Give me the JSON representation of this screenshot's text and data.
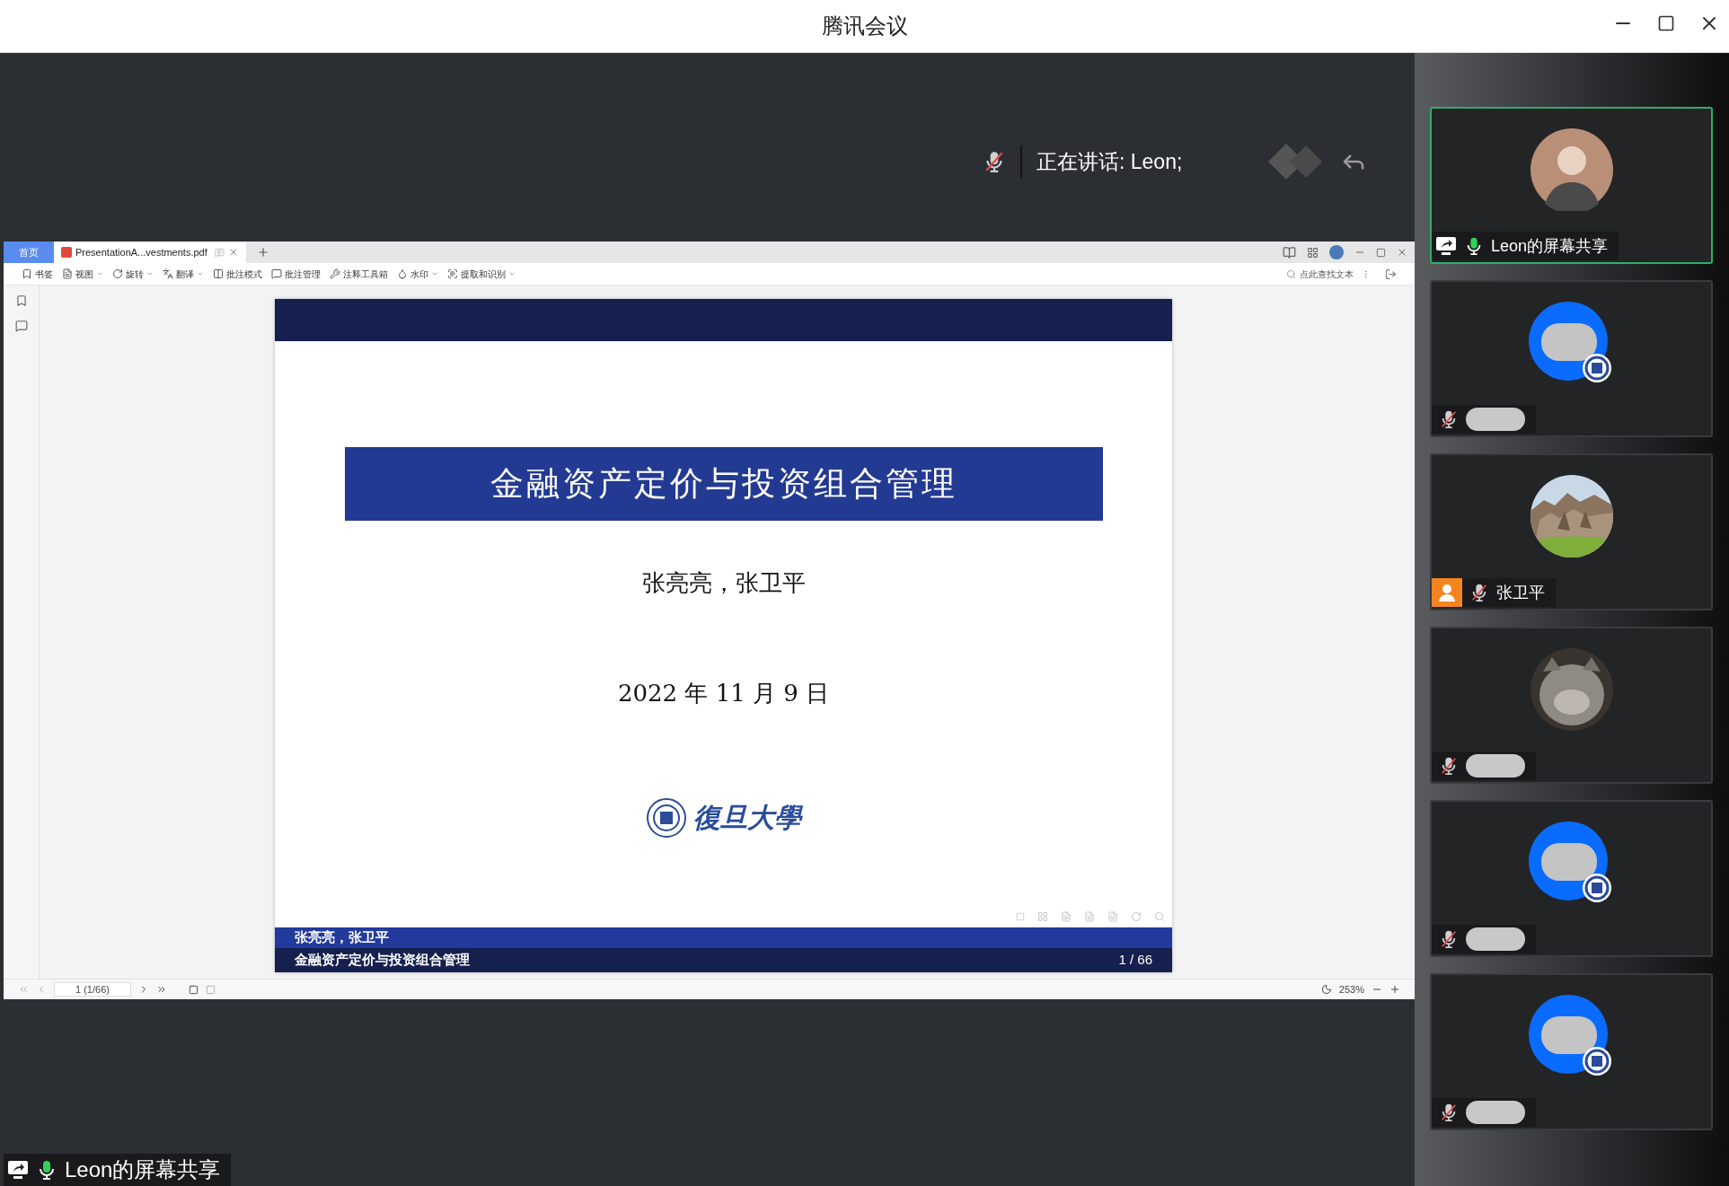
{
  "window": {
    "title": "腾讯会议"
  },
  "speaking": {
    "muted": true,
    "text": "正在讲话: Leon;"
  },
  "viewer": {
    "tabs": [
      {
        "kind": "home",
        "label": "首页",
        "selected": false
      },
      {
        "kind": "doc",
        "label": "PresentationA...vestments.pdf",
        "selected": true
      }
    ],
    "toolbar": [
      {
        "label": "书签",
        "dropdown": false
      },
      {
        "label": "视图",
        "dropdown": true
      },
      {
        "label": "旋转",
        "dropdown": true
      },
      {
        "label": "翻译",
        "dropdown": true
      },
      {
        "label": "批注模式",
        "dropdown": false
      },
      {
        "label": "批注管理",
        "dropdown": false
      },
      {
        "label": "注释工具箱",
        "dropdown": false
      },
      {
        "label": "水印",
        "dropdown": true
      },
      {
        "label": "提取和识别",
        "dropdown": true
      }
    ],
    "search": {
      "placeholder": "点此查找文本"
    },
    "slide": {
      "title": "金融资产定价与投资组合管理",
      "authors": "张亮亮，张卫平",
      "date": "2022 年 11 月 9 日",
      "logo_text": "復旦大學",
      "footer_authors": "张亮亮，张卫平",
      "footer_title": "金融资产定价与投资组合管理",
      "footer_page": "1 / 66"
    },
    "page_field": "1 (1/66)",
    "zoom": "253%"
  },
  "share_label": {
    "text": "Leon的屏幕共享",
    "muted": false
  },
  "participants": [
    {
      "kind": "person",
      "name": "Leon的屏幕共享",
      "sharing": true,
      "host": false,
      "muted": false,
      "active": true
    },
    {
      "kind": "hidden",
      "sharing": false,
      "host": false,
      "muted": true,
      "active": false
    },
    {
      "kind": "landscape",
      "name": "张卫平",
      "sharing": false,
      "host": true,
      "muted": true,
      "active": false
    },
    {
      "kind": "animal",
      "sharing": false,
      "host": false,
      "muted": true,
      "active": false
    },
    {
      "kind": "hidden",
      "sharing": false,
      "host": false,
      "muted": true,
      "active": false
    },
    {
      "kind": "hidden",
      "sharing": false,
      "host": false,
      "muted": true,
      "active": false
    }
  ]
}
